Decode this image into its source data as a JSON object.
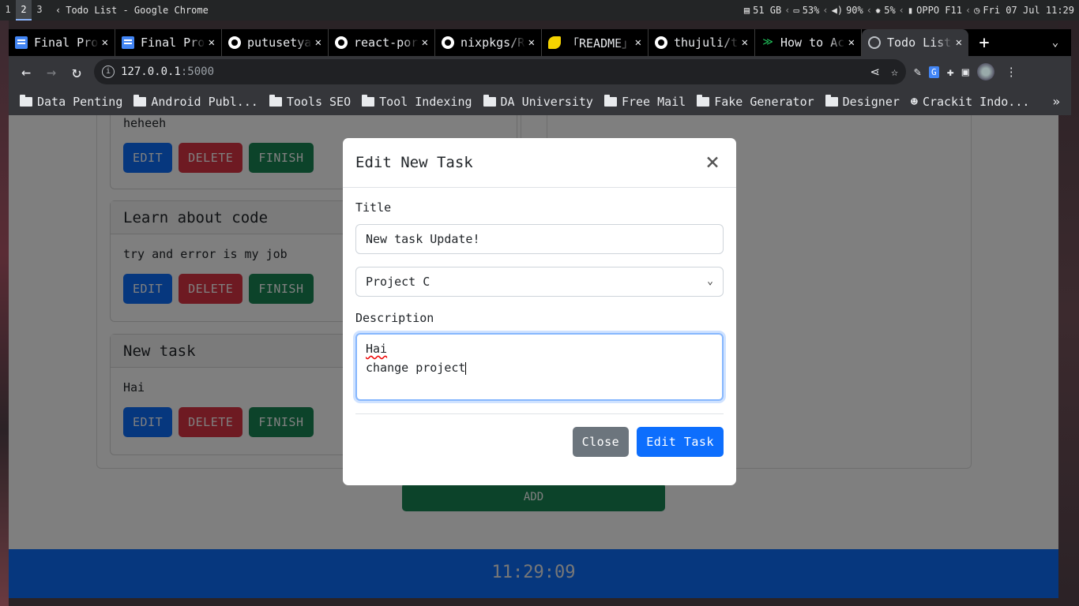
{
  "os_bar": {
    "workspaces": [
      "1",
      "2",
      "3"
    ],
    "window_title": "Todo List - Google Chrome",
    "storage": "51 GB",
    "battery": "53%",
    "volume": "90%",
    "brightness": "5%",
    "network": "OPPO F11",
    "datetime": "Fri 07 Jul 11:29"
  },
  "browser": {
    "tabs": [
      {
        "label": "Final Pro",
        "icon": "docs-icon"
      },
      {
        "label": "Final Pro",
        "icon": "docs-icon"
      },
      {
        "label": "putusetya",
        "icon": "github-icon"
      },
      {
        "label": "react-por",
        "icon": "github-icon"
      },
      {
        "label": "nixpkgs/R",
        "icon": "github-icon"
      },
      {
        "label": "「README」",
        "icon": "lemon-icon"
      },
      {
        "label": "thujuli/t",
        "icon": "github-icon"
      },
      {
        "label": "How to Ac",
        "icon": "code-icon"
      },
      {
        "label": "Todo List",
        "icon": "globe-icon"
      }
    ],
    "url_host": "127.0.0.1",
    "url_port": ":5000",
    "bookmarks": [
      "Data Penting",
      "Android Publ...",
      "Tools SEO",
      "Tool Indexing",
      "DA University",
      "Free Mail",
      "Fake Generator",
      "Designer",
      "Crackit Indo..."
    ]
  },
  "page": {
    "cards": [
      {
        "title": "",
        "description": "heheeh"
      },
      {
        "title": "Learn about code",
        "description": "try and error is my job"
      },
      {
        "title": "New task",
        "description": "Hai"
      }
    ],
    "card_buttons": {
      "edit": "EDIT",
      "delete": "DELETE",
      "finish": "FINISH"
    },
    "add_button": "ADD",
    "clock": "11:29:09"
  },
  "modal": {
    "title": "Edit New Task",
    "title_label": "Title",
    "title_value": "New task Update!",
    "project_selected": "Project C",
    "description_label": "Description",
    "description_line1": "Hai",
    "description_line2": "change project",
    "close_button": "Close",
    "submit_button": "Edit Task"
  }
}
